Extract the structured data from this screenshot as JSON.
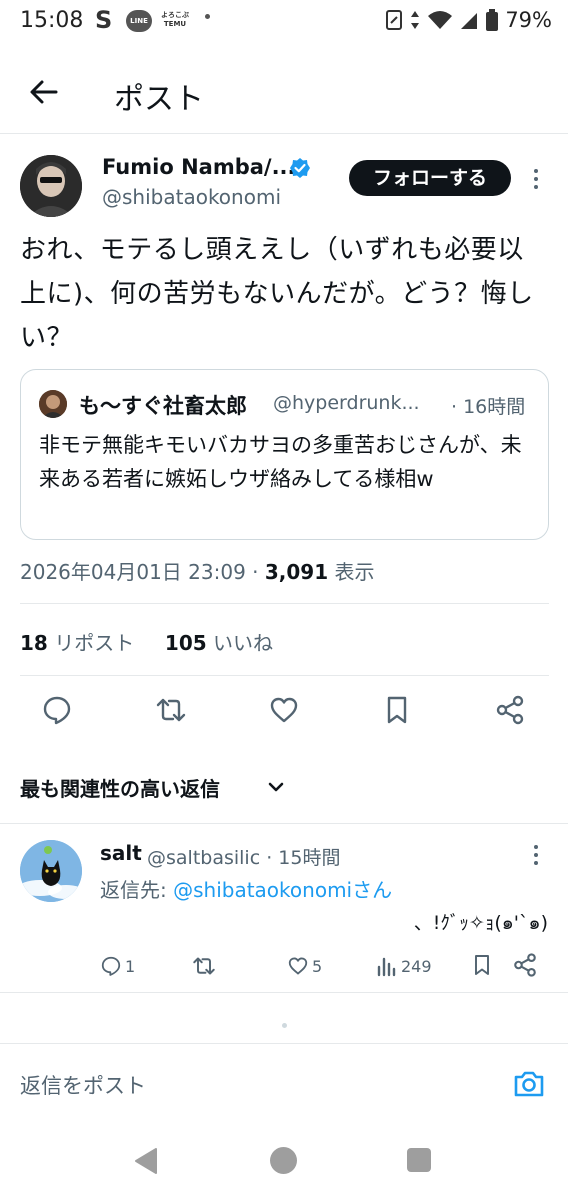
{
  "status_bar": {
    "time": "15:08",
    "s_label": "S",
    "line_label": "LINE",
    "temu_label": "よろこぶ TEMU",
    "battery": "79%"
  },
  "nav": {
    "title": "ポスト"
  },
  "post": {
    "author_name": "Fumio Namba/...",
    "author_handle": "@shibataokonomi",
    "follow_label": "フォローする",
    "text": "おれ、モテるし頭ええし（いずれも必要以上に)、何の苦労もないんだが。どう？悔しい？",
    "quote": {
      "name": "も～すぐ社畜太郎",
      "handle": "@hyperdrunk...",
      "time": "· 16時間",
      "text": "非モテ無能キモいバカサヨの多重苦おじさんが、未来ある若者に嫉妬しウザ絡みしてる様相w"
    },
    "timestamp": "2026年04月01日 23:09 · ",
    "views_count": "3,091",
    "views_label": " 表示",
    "reposts_count": "18",
    "reposts_label": " リポスト",
    "likes_count": "105",
    "likes_label": " いいね"
  },
  "replies_header": {
    "label": "最も関連性の高い返信"
  },
  "reply": {
    "name": "salt",
    "handle": "@saltbasilic · 15時間",
    "replying_prefix": "返信先: ",
    "replying_mention": "@shibataokonomi",
    "replying_suffix": "さん",
    "text": "、!ｸﾞｯ✧ｮ(๑'`๑)",
    "comments": "1",
    "likes": "5",
    "views": "249"
  },
  "composer": {
    "placeholder": "返信をポスト"
  },
  "colors": {
    "accent": "#1d9bf0",
    "text_primary": "#0f1419",
    "text_secondary": "#536471",
    "follow_bg": "#0f1419"
  },
  "icons": [
    "back-arrow-icon",
    "verified-badge-icon",
    "more-vert-icon",
    "reply-icon",
    "repost-icon",
    "like-icon",
    "bookmark-icon",
    "share-icon",
    "chevron-down-icon",
    "views-icon",
    "camera-icon"
  ]
}
